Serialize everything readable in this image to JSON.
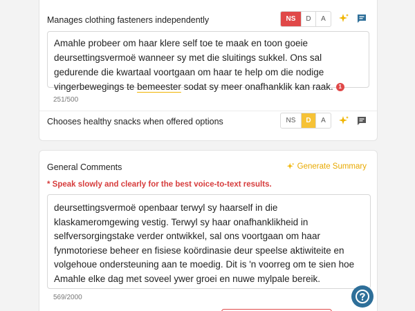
{
  "skills": [
    {
      "label": "Manages clothing fasteners independently",
      "options": [
        "NS",
        "D",
        "A"
      ],
      "selected": "NS",
      "comment_before": "Amahle probeer om haar klere self toe te maak en toon goeie deursettingsvermoë wanneer sy met die sluitings sukkel. Ons sal gedurende die kwartaal voortgaan om haar te help om die nodige vingerbewegings te ",
      "comment_underlined": "bemeester",
      "comment_after": " sodat sy meer onafhanklik kan raak.",
      "issue_count": "1",
      "char_count": "251/500"
    },
    {
      "label": "Chooses healthy snacks when offered options",
      "options": [
        "NS",
        "D",
        "A"
      ],
      "selected": "D"
    }
  ],
  "general": {
    "title": "General Comments",
    "generate_label": "Generate Summary",
    "warning": "* Speak slowly and clearly for the best voice-to-text results.",
    "text": "deursettingsvermoë openbaar terwyl sy haarself in die klaskameromgewing vestig. Terwyl sy haar onafhanklikheid in selfversorgingstake verder ontwikkel, sal ons voortgaan om haar fynmotoriese beheer en fisiese koördinasie deur speelse aktiwiteite en volgehoue ondersteuning aan te moedig. Dit is 'n voorreg om te sien hoe Amahle elke dag met soveel ywer groei en nuwe mylpale bereik.",
    "char_count": "569/2000"
  },
  "colors": {
    "ns_active": "#e04848",
    "d_active": "#f6c236",
    "accent": "#e8a900",
    "warning": "#d63c3c",
    "help": "#2e6f99"
  },
  "icons": {
    "sparkle": "sparkle-icon",
    "comment": "comment-icon",
    "help": "help-icon"
  }
}
